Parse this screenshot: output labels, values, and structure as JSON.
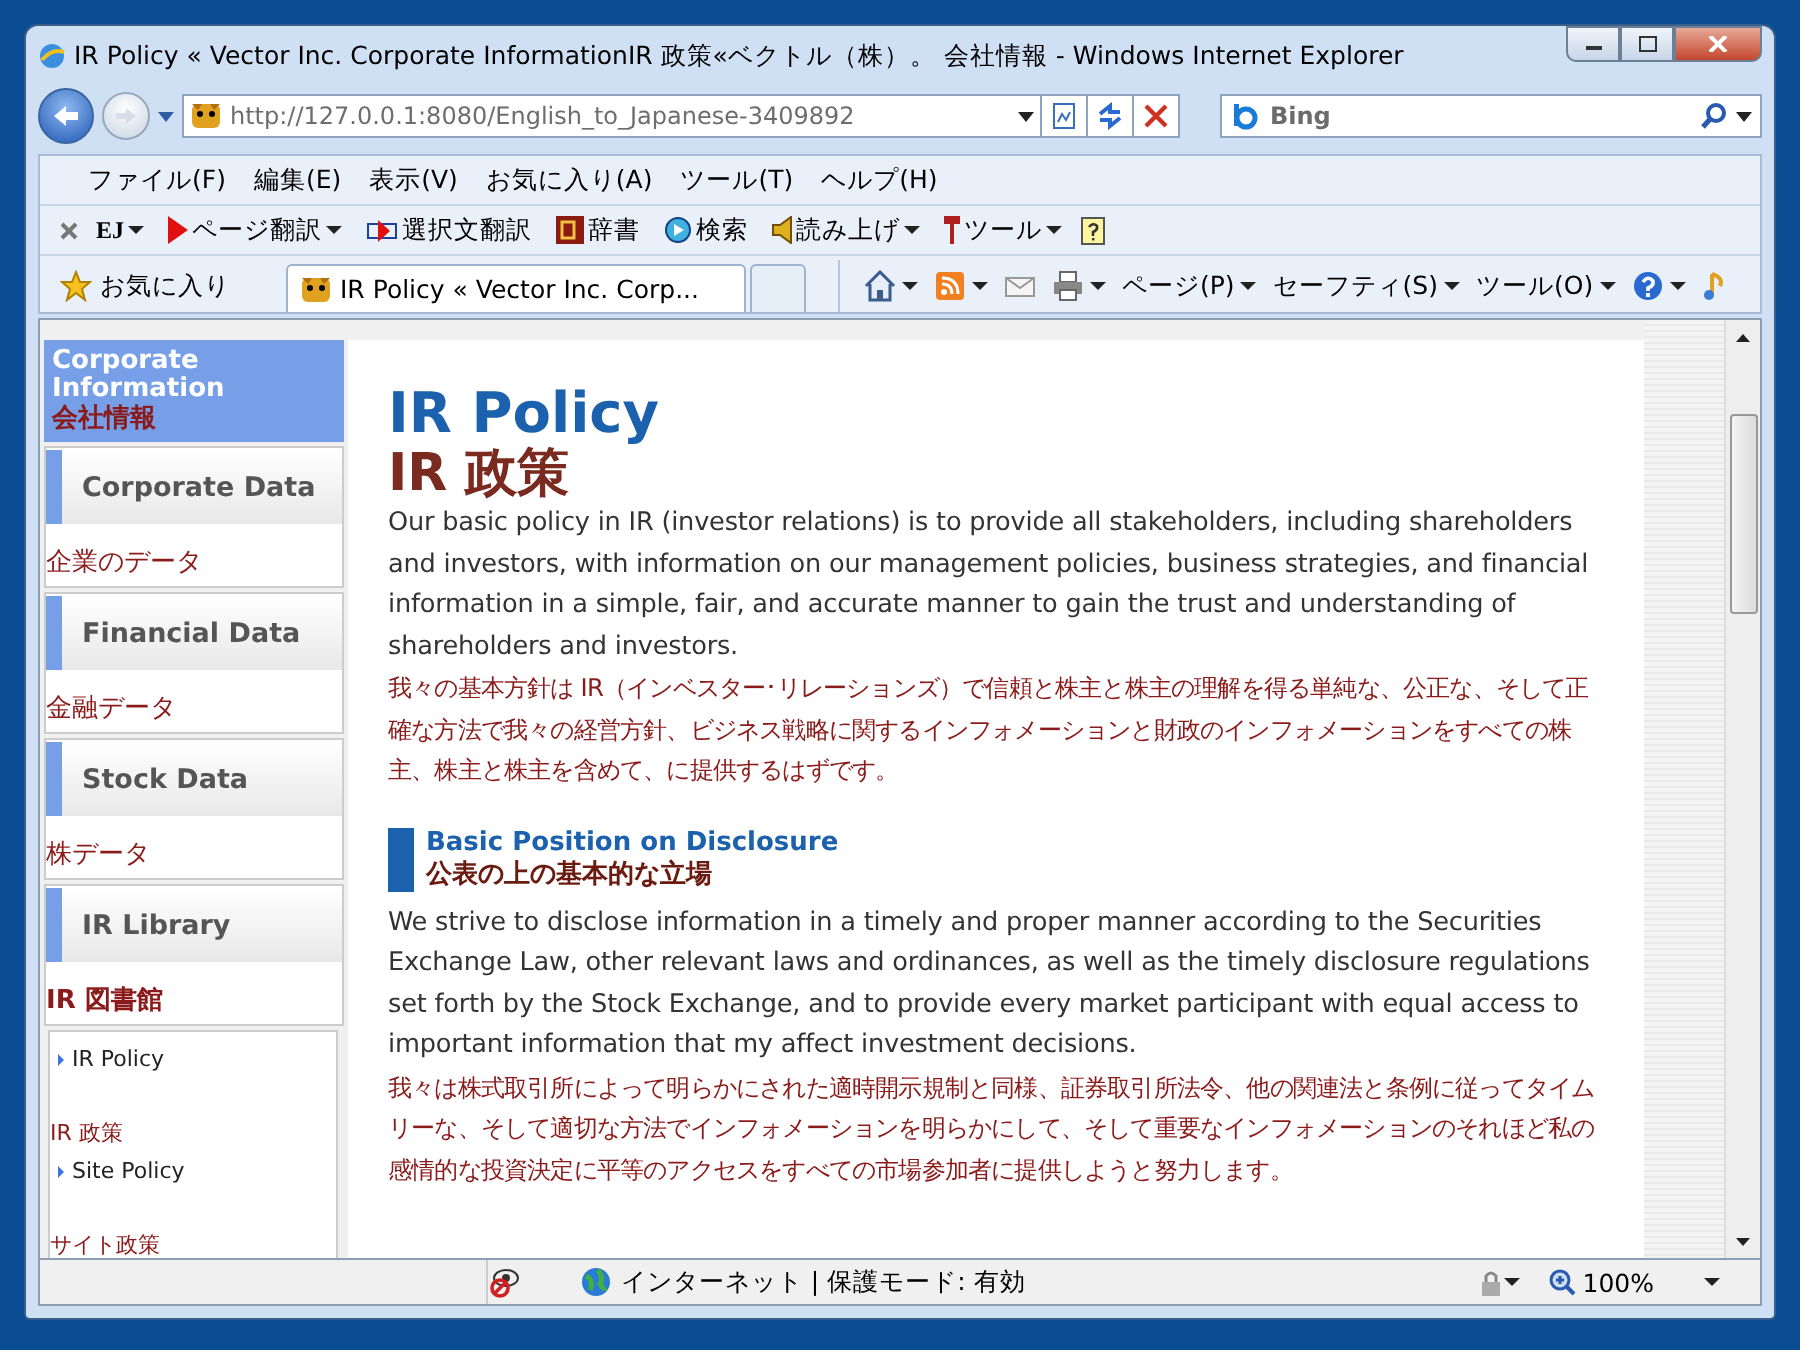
{
  "window": {
    "title": "IR Policy « Vector Inc. Corporate InformationIR 政策«ベクトル（株）。 会社情報 - Windows Internet Explorer"
  },
  "address_bar": {
    "url": "http://127.0.0.1:8080/English_to_Japanese-3409892",
    "search_placeholder": "Bing"
  },
  "menu": [
    "ファイル(F)",
    "編集(E)",
    "表示(V)",
    "お気に入り(A)",
    "ツール(T)",
    "ヘルプ(H)"
  ],
  "translate_toolbar": [
    {
      "kind": "logo",
      "label": "EJ"
    },
    {
      "kind": "translate",
      "label": "ページ翻訳"
    },
    {
      "kind": "selection",
      "label": "選択文翻訳"
    },
    {
      "kind": "dictionary",
      "label": "辞書"
    },
    {
      "kind": "search",
      "label": "検索"
    },
    {
      "kind": "speak",
      "label": "読み上げ"
    },
    {
      "kind": "tools",
      "label": "ツール"
    }
  ],
  "favorites": {
    "label": "お気に入り"
  },
  "tabs": [
    {
      "label": "IR Policy « Vector Inc. Corp...",
      "selected": true
    }
  ],
  "command_bar": [
    {
      "kind": "home"
    },
    {
      "kind": "feed"
    },
    {
      "kind": "mail"
    },
    {
      "kind": "print"
    },
    {
      "kind": "menu",
      "label": "ページ(P)"
    },
    {
      "kind": "menu",
      "label": "セーフティ(S)"
    },
    {
      "kind": "menu",
      "label": "ツール(O)"
    },
    {
      "kind": "help"
    }
  ],
  "sidebar": {
    "header": {
      "en": "Corporate Information",
      "ja": "会社情報"
    },
    "items": [
      {
        "en": "Corporate Data",
        "ja": "企業のデータ"
      },
      {
        "en": "Financial Data",
        "ja": "金融データ"
      },
      {
        "en": "Stock Data",
        "ja": "株データ"
      },
      {
        "en": "IR Library",
        "ja": "IR 図書館"
      }
    ],
    "sublinks": [
      {
        "en": "IR Policy",
        "ja": "IR 政策"
      },
      {
        "en": "Site Policy",
        "ja": "サイト政策"
      }
    ]
  },
  "content": {
    "title_en": "IR Policy",
    "title_ja": "IR 政策",
    "intro_en": "Our basic policy in IR (investor relations) is to provide all stakeholders, including shareholders and investors, with information on our management policies, business strategies, and financial information in a simple, fair, and accurate manner to gain the trust and understanding of shareholders and investors.",
    "intro_ja": "我々の基本方針は IR（インベスター･リレーションズ）で信頼と株主と株主の理解を得る単純な、公正な、そして正確な方法で我々の経営方針、ビジネス戦略に関するインフォメーションと財政のインフォメーションをすべての株主、株主と株主を含めて、に提供するはずです。",
    "section": {
      "heading_en": "Basic Position on Disclosure",
      "heading_ja": "公表の上の基本的な立場",
      "body_en": "We strive to disclose information in a timely and proper manner according to the Securities Exchange Law, other relevant laws and ordinances, as well as the timely disclosure regulations set forth by the Stock Exchange, and to provide every market participant with equal access to important information that my affect investment decisions.",
      "body_ja": "我々は株式取引所によって明らかにされた適時開示規制と同様、証券取引所法令、他の関連法と条例に従ってタイムリーな、そして適切な方法でインフォメーションを明らかにして、そして重要なインフォメーションのそれほど私の感情的な投資決定に平等のアクセスをすべての市場参加者に提供しようと努力します。"
    }
  },
  "status_bar": {
    "zone": "インターネット | 保護モード: 有効",
    "zoom": "100%"
  }
}
